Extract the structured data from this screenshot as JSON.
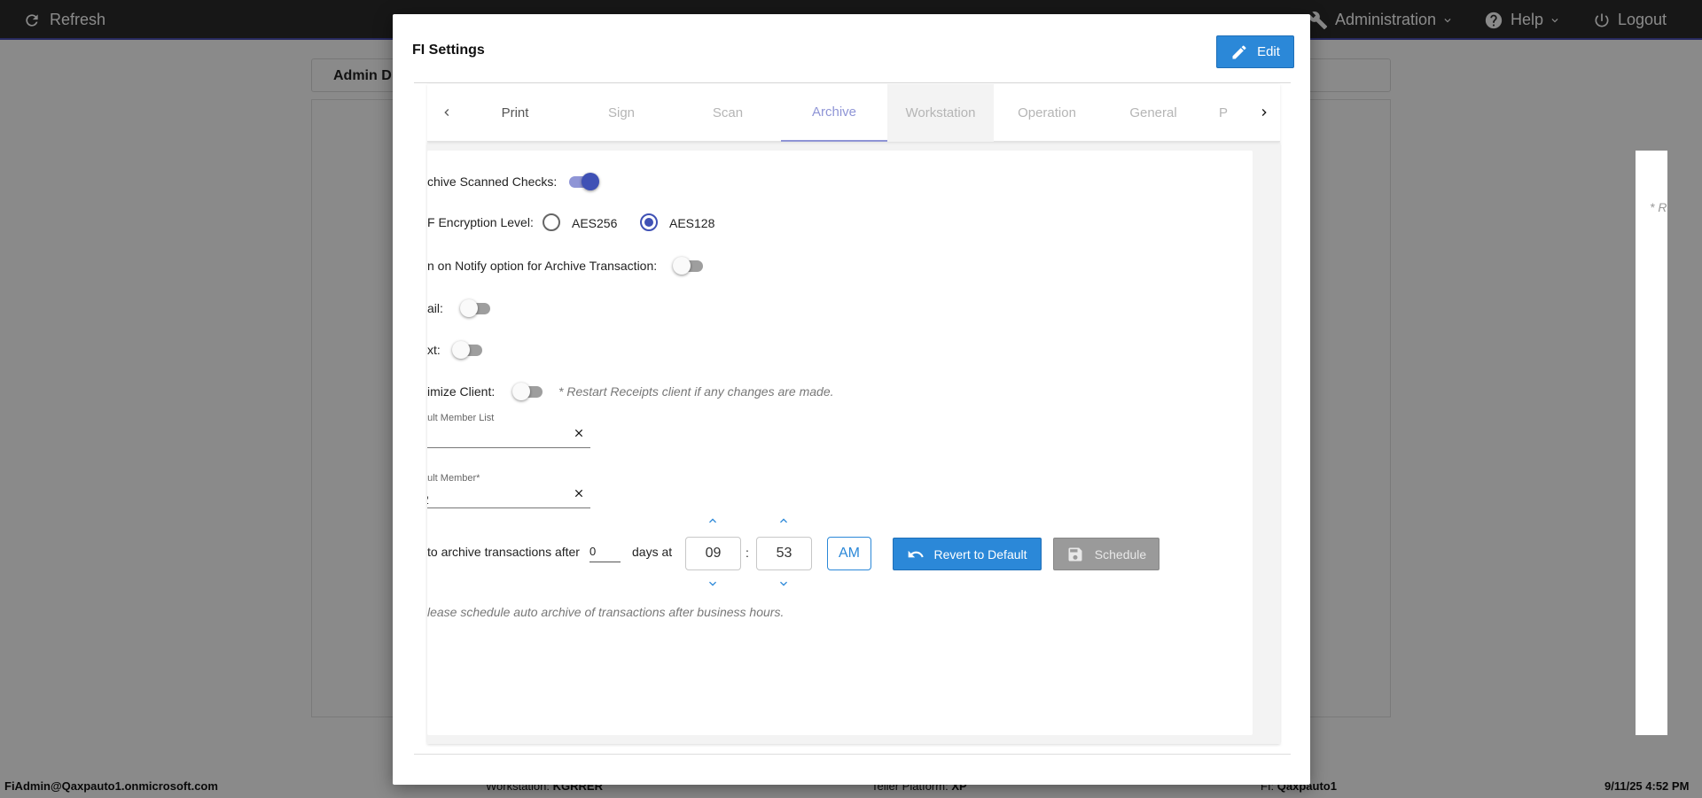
{
  "topbar": {
    "refresh_label": "Refresh",
    "administration_label": "Administration",
    "help_label": "Help",
    "logout_label": "Logout"
  },
  "background": {
    "card_title": "Admin D"
  },
  "footer": {
    "user": "FiAdmin@Qaxpauto1.onmicrosoft.com",
    "workstation_label": "Workstation:",
    "workstation_value": "KGRRER",
    "platform_label": "Teller Platform:",
    "platform_value": "XP",
    "fi_label": "FI:",
    "fi_value": "Qaxpauto1",
    "datetime": "9/11/25 4:52 PM"
  },
  "modal": {
    "title": "FI Settings",
    "edit_label": "Edit",
    "tabs": [
      {
        "label": "Print"
      },
      {
        "label": "Sign"
      },
      {
        "label": "Scan"
      },
      {
        "label": "Archive"
      },
      {
        "label": "Workstation"
      },
      {
        "label": "Operation"
      },
      {
        "label": "General"
      },
      {
        "label": "P"
      }
    ],
    "active_tab": "Archive",
    "archive": {
      "archive_checks_label": "chive Scanned Checks:",
      "archive_checks_on": true,
      "encryption_label": "F Encryption Level:",
      "encryption_options": [
        "AES256",
        "AES128"
      ],
      "encryption_selected": "AES128",
      "notify_label": "n on Notify option for Archive Transaction:",
      "notify_on": false,
      "email_label": "ail:",
      "email_on": false,
      "text_label": "xt:",
      "text_on": false,
      "minimize_label": "imize Client:",
      "minimize_on": false,
      "minimize_note": "* Restart Receipts client if any changes are made.",
      "default_member_list_label": "ault Member List",
      "default_member_list_value": "",
      "default_member_label": "ault Member*",
      "default_member_value": "2",
      "auto_archive_prefix": "to archive transactions after",
      "auto_archive_days": "0",
      "days_at_label": "days at",
      "hour": "09",
      "time_separator": ":",
      "minute": "53",
      "ampm": "AM",
      "revert_label": "Revert to Default",
      "schedule_label": "Schedule",
      "schedule_note": "lease schedule auto archive of transactions after business hours."
    },
    "side_note": "* R"
  },
  "colors": {
    "accent": "#2b88d8",
    "toggle_on": "#3f51b5",
    "topbar": "#2c2c2c"
  }
}
